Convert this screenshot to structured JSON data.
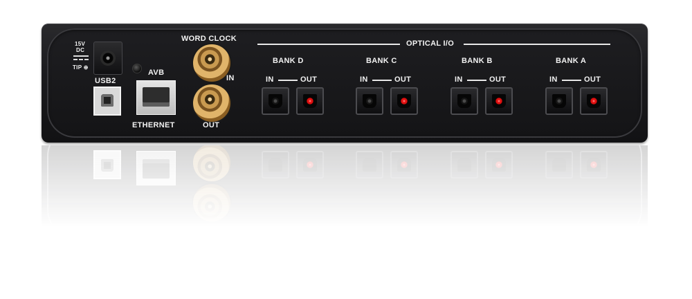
{
  "power": {
    "voltage": "15V",
    "type": "DC",
    "tip": "TIP ⊕"
  },
  "usb": {
    "label": "USB2"
  },
  "avb": {
    "label": "AVB",
    "port_label": "ETHERNET"
  },
  "word_clock": {
    "title": "WORD CLOCK",
    "in_label": "IN",
    "out_label": "OUT"
  },
  "optical": {
    "title": "OPTICAL I/O",
    "banks": [
      {
        "name": "BANK D",
        "in": "IN",
        "out": "OUT"
      },
      {
        "name": "BANK C",
        "in": "IN",
        "out": "OUT"
      },
      {
        "name": "BANK B",
        "in": "IN",
        "out": "OUT"
      },
      {
        "name": "BANK A",
        "in": "IN",
        "out": "OUT"
      }
    ]
  },
  "colors": {
    "chassis": "#1b1b1e",
    "label": "#f2f2f2",
    "bnc_gold": "#d9a85a",
    "optical_led": "#e01010"
  }
}
